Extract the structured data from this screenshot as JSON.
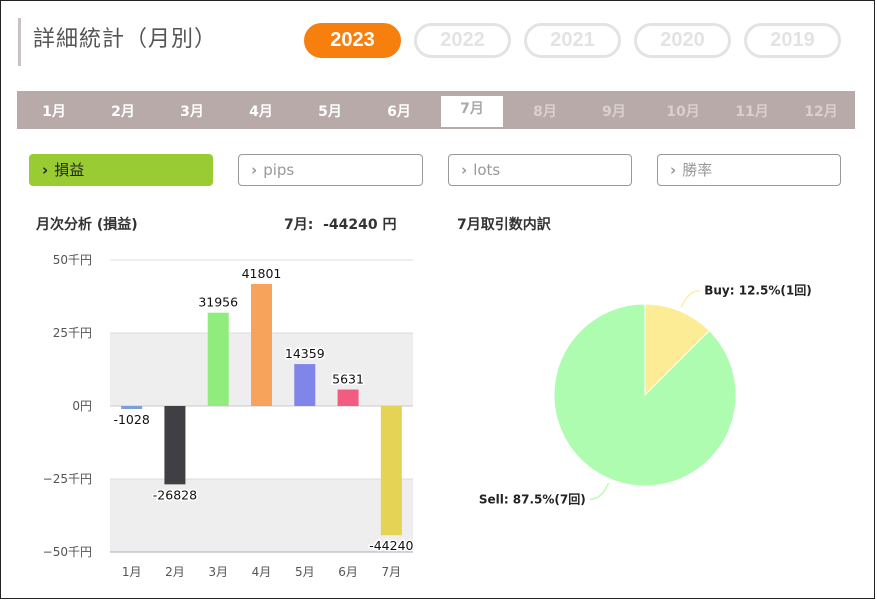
{
  "page": {
    "title": "詳細統計（月別）"
  },
  "years": [
    "2023",
    "2022",
    "2021",
    "2020",
    "2019"
  ],
  "active_year": "2023",
  "months": [
    "1月",
    "2月",
    "3月",
    "4月",
    "5月",
    "6月",
    "7月",
    "8月",
    "9月",
    "10月",
    "11月",
    "12月"
  ],
  "active_month": "7月",
  "metrics": [
    "損益",
    "pips",
    "lots",
    "勝率"
  ],
  "active_metric": "損益",
  "bar_panel": {
    "title": "月次分析 (損益)",
    "summary_label": "7月:",
    "summary_value": "-44240",
    "summary_unit": "円"
  },
  "pie_panel": {
    "title": "7月取引数内訳"
  },
  "chart_data": [
    {
      "type": "bar",
      "title": "月次分析 (損益)",
      "categories": [
        "1月",
        "2月",
        "3月",
        "4月",
        "5月",
        "6月",
        "7月"
      ],
      "values": [
        -1028,
        -26828,
        31956,
        41801,
        14359,
        5631,
        -44240
      ],
      "value_labels": [
        "-1028",
        "-26828",
        "31956",
        "41801",
        "14359",
        "5631",
        "-44240"
      ],
      "colors": [
        "#7c9fd8",
        "#3f3f44",
        "#90ed7d",
        "#f7a35c",
        "#8085e9",
        "#f15c80",
        "#e4d354"
      ],
      "ylim": [
        -50000,
        50000
      ],
      "yticks": [
        50000,
        25000,
        0,
        -25000,
        -50000
      ],
      "ytick_labels": [
        "50千円",
        "25千円",
        "0円",
        "−25千円",
        "−50千円"
      ],
      "grid": true
    },
    {
      "type": "pie",
      "title": "7月取引数内訳",
      "slices": [
        {
          "label": "Buy: 12.5%(1回)",
          "value": 12.5,
          "color": "#fdec96"
        },
        {
          "label": "Sell: 87.5%(7回)",
          "value": 87.5,
          "color": "#adfcaf"
        }
      ]
    }
  ]
}
